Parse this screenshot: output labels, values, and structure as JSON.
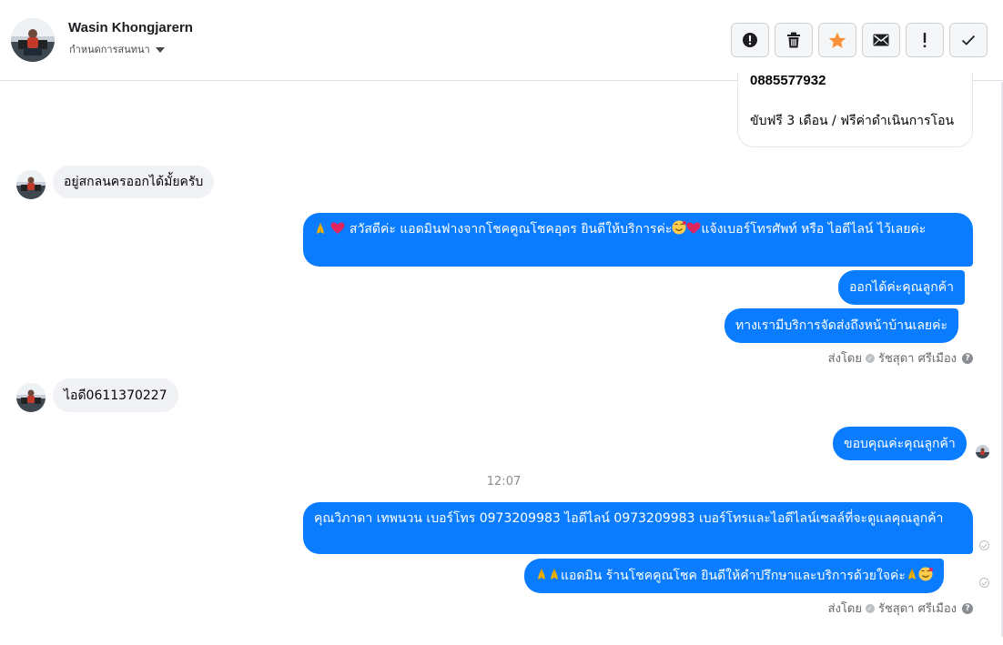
{
  "header": {
    "name": "Wasin Khongjarern",
    "subtitle": "กำหนดการสนทนา",
    "buttons": {
      "report": "report-icon",
      "delete": "trash-icon",
      "star": "star-icon",
      "mail": "mail-icon",
      "important": "exclamation-icon",
      "done": "check-icon"
    },
    "star_color": "#f7923b"
  },
  "partial_message": {
    "phone": "0885577932",
    "text": "ขับฟรี 3 เดือน / ฟรีค่าดำเนินการโอน"
  },
  "messages": {
    "in1": "อยู่สกลนครออกได้มั้ยครับ",
    "out1_text": "สวัสดีค่ะ แอดมินฟางจากโชคคูณโชคอุดร ยินดีให้บริการค่ะ",
    "out1_text2": "แจ้งเบอร์โทรศัพท์ หรือ ไอดีไลน์  ไว้เลยค่ะ",
    "out2": "ออกได้ค่ะคุณลูกค้า",
    "out3": "ทางเรามีบริการจัดส่งถึงหน้าบ้านเลยค่ะ",
    "in2": "ไอดี0611370227",
    "out4": "ขอบคุณค่ะคุณลูกค้า",
    "time": "12:07",
    "out5": "คุณวิภาดา เทพนวน        เบอร์โทร 0973209983  ไอดีไลน์ 0973209983  เบอร์โทรและไอดีไลน์เซลล์ที่จะดูแลคุณลูกค้า",
    "out6_text": "แอดมิน ร้านโชคคูณโชค ยินดีให้คำปรึกษาและบริการด้วยใจค่ะ"
  },
  "sent_by": {
    "label": "ส่งโดย",
    "agent": "รัชสุดา ศรีเมือง",
    "help": "?"
  },
  "colors": {
    "outgoing": "#0a7cff",
    "incoming": "#f0f2f5"
  }
}
